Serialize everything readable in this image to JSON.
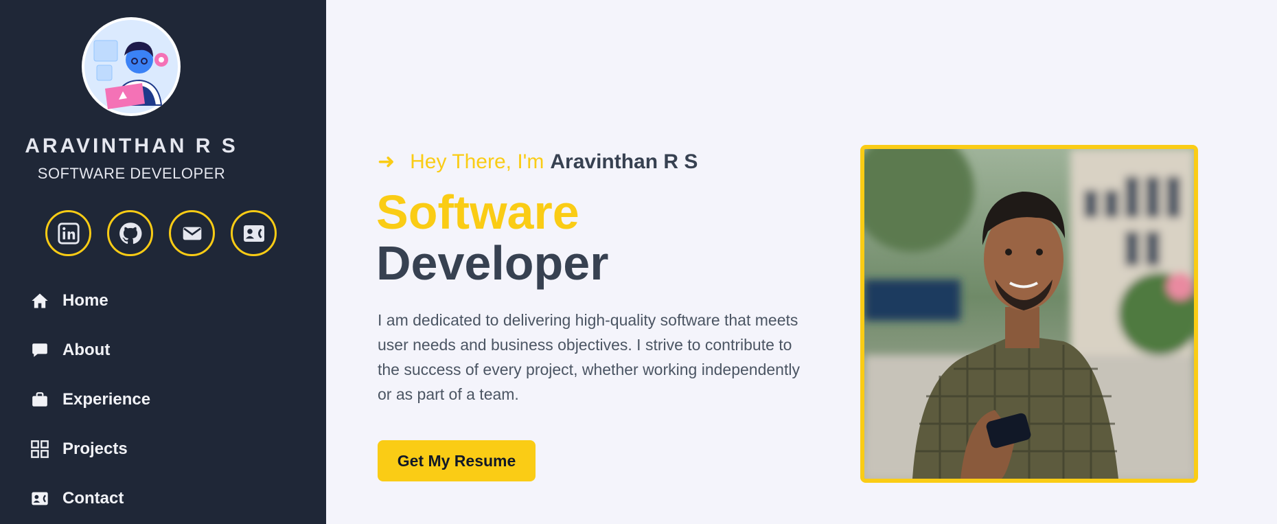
{
  "profile": {
    "name": "ARAVINTHAN R S",
    "role": "SOFTWARE DEVELOPER"
  },
  "socials": [
    {
      "icon": "linkedin-icon"
    },
    {
      "icon": "github-icon"
    },
    {
      "icon": "mail-icon"
    },
    {
      "icon": "contact-card-icon"
    }
  ],
  "nav": {
    "items": [
      {
        "label": "Home",
        "icon": "home-icon"
      },
      {
        "label": "About",
        "icon": "chat-bubble-icon"
      },
      {
        "label": "Experience",
        "icon": "briefcase-icon"
      },
      {
        "label": "Projects",
        "icon": "grid-icon"
      },
      {
        "label": "Contact",
        "icon": "contact-card-icon"
      }
    ]
  },
  "hero": {
    "arrow": "➜",
    "greeting": "Hey There, I'm",
    "name": "Aravinthan R S",
    "headline_line1": "Software",
    "headline_line2": "Developer",
    "intro": "I am dedicated to delivering high-quality software that meets user needs and business objectives. I strive to contribute to the success of every project, whether working independently or as part of a team.",
    "cta_label": "Get My Resume"
  },
  "colors": {
    "sidebar_bg": "#1f2737",
    "accent": "#facc15",
    "page_bg": "#f4f4fb",
    "heading_dark": "#374151"
  }
}
